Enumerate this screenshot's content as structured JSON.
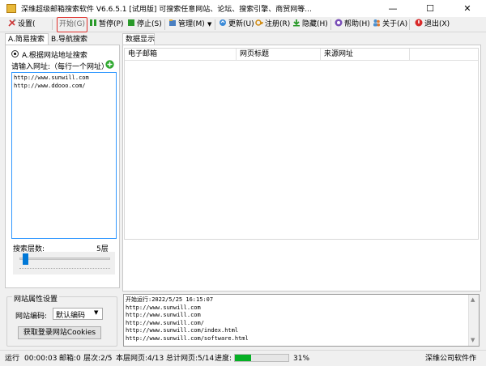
{
  "window": {
    "title": "深维超级邮箱搜索软件 V6.6.5.1 [试用版] 可搜索任意网站、论坛、搜索引擎、商贸网等...",
    "minimize": "—",
    "maximize": "☐",
    "close": "✕"
  },
  "toolbar": {
    "settings": "设置(",
    "start": "开始(G)",
    "pause": "暂停(P)",
    "stop": "停止(S)",
    "manage": "管理(M)",
    "update": "更新(U)",
    "register": "注册(R)",
    "hide": "隐藏(H)",
    "help": "帮助(H)",
    "about": "关于(A)",
    "exit": "退出(X)"
  },
  "left_tabs": [
    "A.简易搜索",
    "B.导航搜索"
  ],
  "simple_search": {
    "radio_label": "A.根据网站地址搜索",
    "url_label": "请输入网址:（每行一个网址）",
    "urls": [
      "http://www.sunwill.com",
      "http://www.ddooo.com/"
    ],
    "depth_label": "搜索层数:",
    "depth_value": "5层",
    "depth_level": 0.05
  },
  "site_props": {
    "group_title": "网站属性设置",
    "encoding_label": "网站编码:",
    "encoding_value": "默认编码",
    "cookies_button": "获取登录网站Cookies"
  },
  "data_panel": {
    "tab": "数据显示",
    "columns": [
      "电子邮箱",
      "网页标题",
      "来源网址"
    ]
  },
  "log": {
    "lines": [
      "开始运行:2022/5/25 16:15:07",
      "http://www.sunwill.com",
      "http://www.sunwill.com",
      "http://www.sunwill.com/",
      "http://www.sunwill.com/index.html",
      "http://www.sunwill.com/software.html"
    ]
  },
  "status": {
    "run_label": "运行",
    "run_time": "00:00:03",
    "email_count": "邮箱:0",
    "level": "层次:2/5",
    "page_this_level": "本层网页:4/13",
    "total_pages": "总计网页:5/14",
    "progress_label": "进度:",
    "progress_text": "31%",
    "progress": 0.31,
    "company": "深维公司软件作"
  },
  "colors": {
    "accent_blue": "#3399ff",
    "progress_green": "#06b025",
    "highlight_red": "#e0302c"
  },
  "icons": {
    "settings": "gear-icon",
    "pause": "pause-icon",
    "stop": "stop-icon",
    "manage": "manage-icon",
    "update": "update-icon",
    "register": "register-icon",
    "hide": "hide-icon",
    "help": "help-icon",
    "about": "about-icon",
    "exit": "exit-icon",
    "add": "add-icon"
  }
}
